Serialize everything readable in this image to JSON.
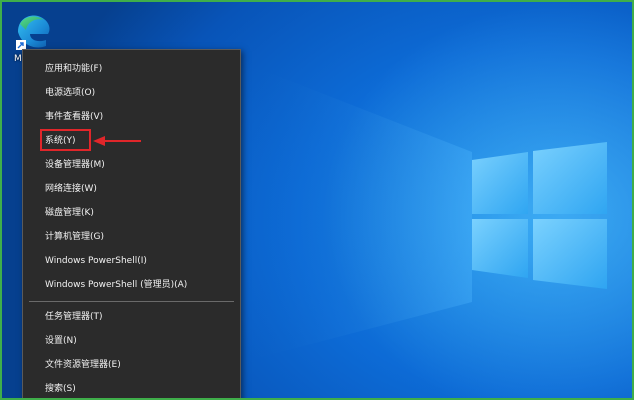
{
  "desktop": {
    "icon_name": "edge-icon",
    "icon_label": "M"
  },
  "menu": {
    "items": [
      {
        "label": "应用和功能(F)"
      },
      {
        "label": "电源选项(O)"
      },
      {
        "label": "事件查看器(V)"
      },
      {
        "label": "系统(Y)"
      },
      {
        "label": "设备管理器(M)"
      },
      {
        "label": "网络连接(W)"
      },
      {
        "label": "磁盘管理(K)"
      },
      {
        "label": "计算机管理(G)"
      },
      {
        "label": "Windows PowerShell(I)"
      },
      {
        "label": "Windows PowerShell (管理员)(A)"
      },
      {
        "label": "任务管理器(T)"
      },
      {
        "label": "设置(N)"
      },
      {
        "label": "文件资源管理器(E)"
      },
      {
        "label": "搜索(S)"
      }
    ]
  },
  "annotation": {
    "highlight_color": "#e0262a"
  },
  "colors": {
    "frame_border": "#3fae4a",
    "menu_background": "#2b2b2b",
    "desktop_blue": "#0d6bd6"
  }
}
